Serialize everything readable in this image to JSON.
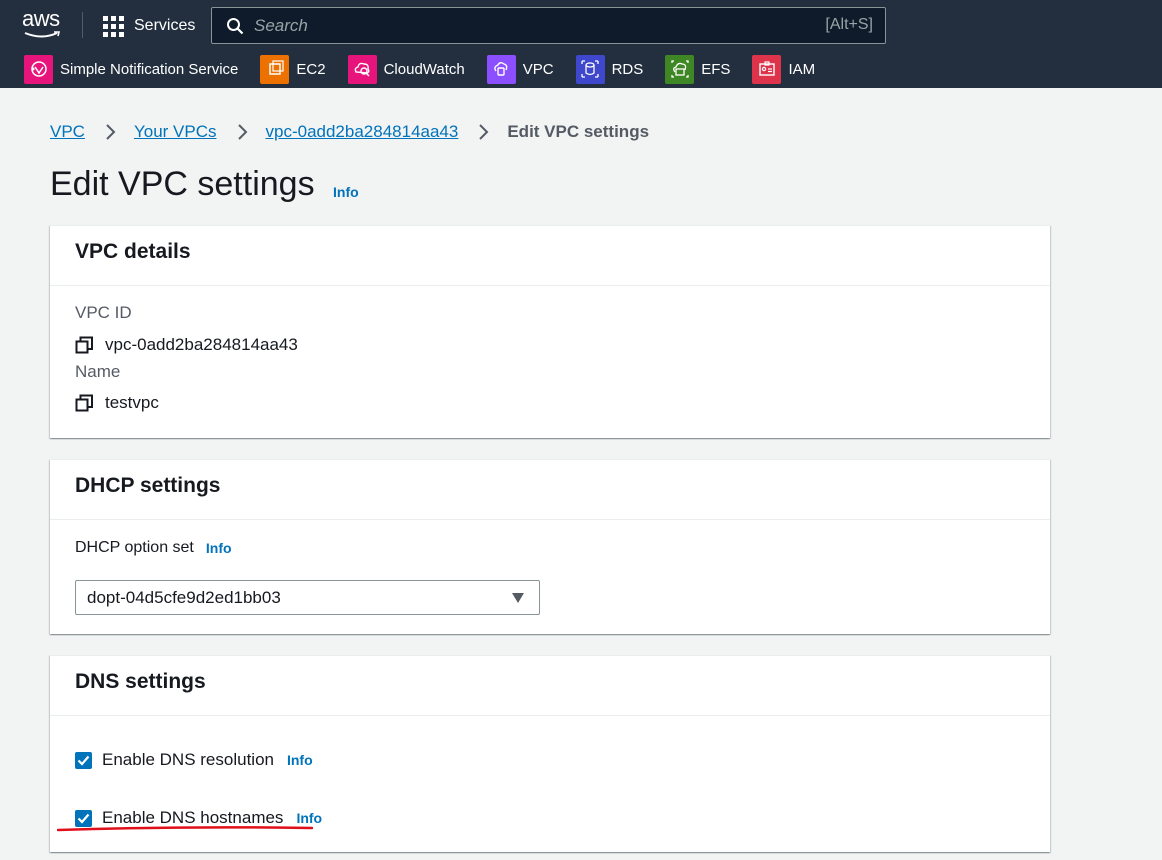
{
  "nav": {
    "logo": "aws",
    "services_label": "Services",
    "search_placeholder": "Search",
    "search_shortcut": "[Alt+S]",
    "favorites": [
      {
        "label": "Simple Notification Service",
        "color": "#e7157b",
        "icon": "sns-icon"
      },
      {
        "label": "EC2",
        "color": "#ed7100",
        "icon": "ec2-icon"
      },
      {
        "label": "CloudWatch",
        "color": "#e7157b",
        "icon": "cloudwatch-icon"
      },
      {
        "label": "VPC",
        "color": "#8c4fff",
        "icon": "vpc-icon"
      },
      {
        "label": "RDS",
        "color": "#3f48cc",
        "icon": "rds-icon"
      },
      {
        "label": "EFS",
        "color": "#3f8624",
        "icon": "efs-icon"
      },
      {
        "label": "IAM",
        "color": "#dd344c",
        "icon": "iam-icon"
      }
    ]
  },
  "breadcrumb": {
    "items": [
      "VPC",
      "Your VPCs",
      "vpc-0add2ba284814aa43"
    ],
    "current": "Edit VPC settings"
  },
  "page": {
    "title": "Edit VPC settings",
    "info": "Info"
  },
  "vpc_details": {
    "title": "VPC details",
    "vpc_id_label": "VPC ID",
    "vpc_id_value": "vpc-0add2ba284814aa43",
    "name_label": "Name",
    "name_value": "testvpc"
  },
  "dhcp": {
    "title": "DHCP settings",
    "option_label": "DHCP option set",
    "info": "Info",
    "selected": "dopt-04d5cfe9d2ed1bb03"
  },
  "dns": {
    "title": "DNS settings",
    "resolution_label": "Enable DNS resolution",
    "resolution_checked": true,
    "hostnames_label": "Enable DNS hostnames",
    "hostnames_checked": true,
    "info": "Info"
  },
  "colors": {
    "nav_bg": "#232f3e",
    "link": "#0073bb",
    "checkbox": "#0073bb",
    "annotation": "#e0101a"
  }
}
